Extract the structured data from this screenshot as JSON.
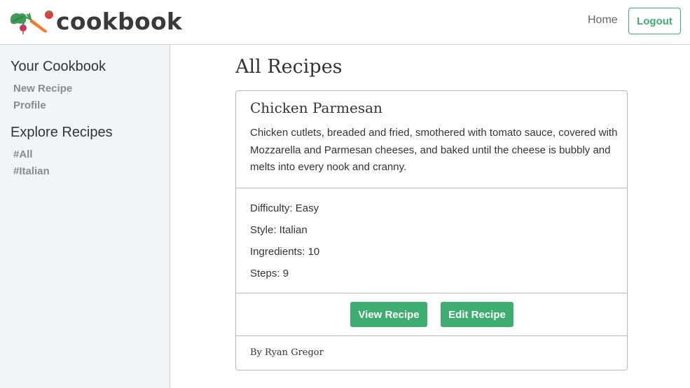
{
  "header": {
    "brand": "cookbook",
    "home_label": "Home",
    "logout_label": "Logout"
  },
  "sidebar": {
    "sections": [
      {
        "heading": "Your Cookbook",
        "links": [
          "New Recipe",
          "Profile"
        ]
      },
      {
        "heading": "Explore Recipes",
        "links": [
          "#All",
          "#Italian"
        ]
      }
    ]
  },
  "main": {
    "title": "All Recipes",
    "recipe": {
      "title": "Chicken Parmesan",
      "description": "Chicken cutlets, breaded and fried, smothered with tomato sauce, covered with Mozzarella and Parmesan cheeses, and baked until the cheese is bubbly and melts into every nook and cranny.",
      "difficulty": "Difficulty: Easy",
      "style": "Style: Italian",
      "ingredients": "Ingredients: 10",
      "steps": "Steps: 9",
      "view_label": "View Recipe",
      "edit_label": "Edit Recipe",
      "author": "By Ryan Gregor"
    }
  },
  "colors": {
    "accent": "#3dae6f",
    "sidebar_bg": "#f3f4f6",
    "text": "#333333",
    "muted": "#8a8a8a"
  },
  "icons": [
    "kale-icon",
    "radish-icon",
    "carrot-icon",
    "tomato-icon"
  ]
}
